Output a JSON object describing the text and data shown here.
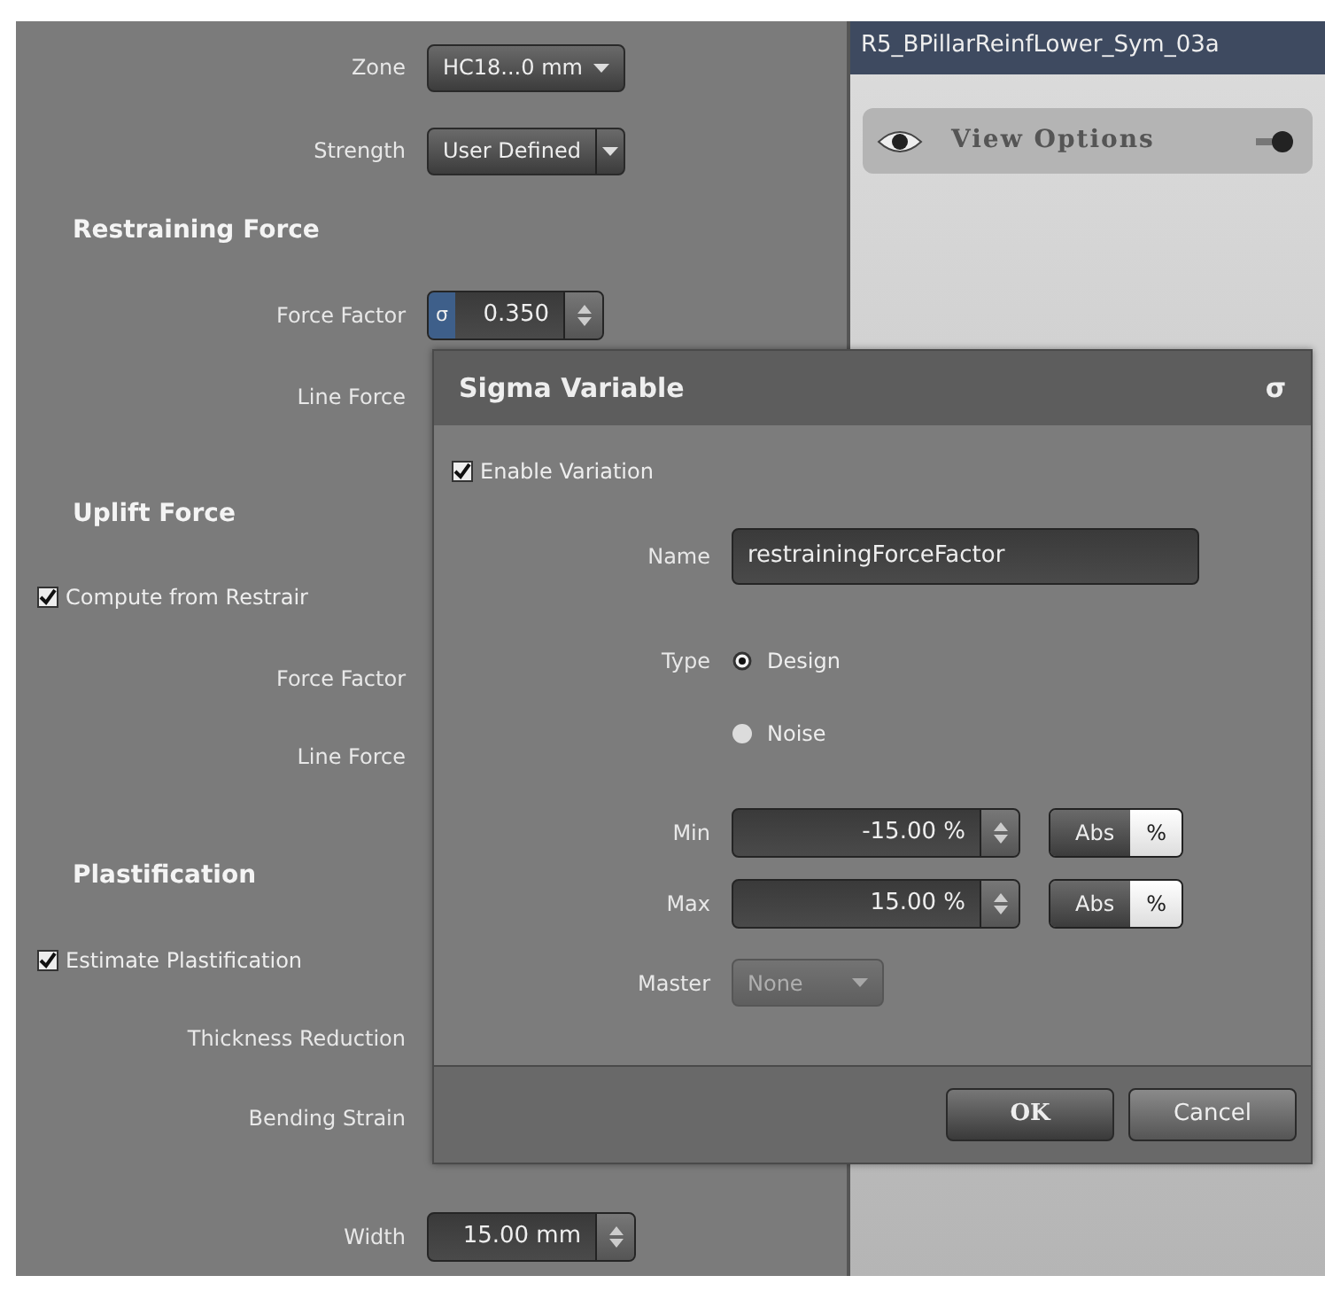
{
  "left_panel": {
    "rows": [
      {
        "kind": "dropdown",
        "label": "Zone",
        "value": "HC18...0 mm"
      },
      {
        "kind": "split_dropdown",
        "label": "Strength",
        "value": "User Defined"
      },
      {
        "kind": "heading",
        "label": "Restraining Force"
      },
      {
        "kind": "sigma_spin",
        "label": "Force Factor",
        "sigma": "σ",
        "value": "0.350"
      },
      {
        "kind": "label",
        "label": "Line Force"
      },
      {
        "kind": "heading",
        "label": "Uplift Force"
      },
      {
        "kind": "checkbox",
        "label": "Compute from Restrair",
        "checked": true
      },
      {
        "kind": "label",
        "label": "Force Factor"
      },
      {
        "kind": "label",
        "label": "Line Force"
      },
      {
        "kind": "heading",
        "label": "Plastification"
      },
      {
        "kind": "checkbox",
        "label": "Estimate Plastification",
        "checked": true
      },
      {
        "kind": "label",
        "label": "Thickness Reduction"
      },
      {
        "kind": "label",
        "label": "Bending Strain"
      },
      {
        "kind": "spin",
        "label": "Width",
        "value": "15.00 mm"
      }
    ]
  },
  "viewer": {
    "title": "R5_BPillarReinfLower_Sym_03a",
    "view_options": "View Options"
  },
  "dialog": {
    "title": "Sigma Variable",
    "title_symbol": "σ",
    "enable_variation": {
      "label": "Enable Variation",
      "checked": true
    },
    "name": {
      "label": "Name",
      "value": "restrainingForceFactor"
    },
    "type": {
      "label": "Type",
      "options": [
        {
          "label": "Design",
          "selected": true
        },
        {
          "label": "Noise",
          "selected": false
        }
      ]
    },
    "ranges": [
      {
        "label": "Min",
        "value": "-15.00 %",
        "modes": [
          {
            "label": "Abs",
            "selected": false
          },
          {
            "label": "%",
            "selected": true
          }
        ]
      },
      {
        "label": "Max",
        "value": "15.00 %",
        "modes": [
          {
            "label": "Abs",
            "selected": false
          },
          {
            "label": "%",
            "selected": true
          }
        ]
      }
    ],
    "master": {
      "label": "Master",
      "value": "None",
      "disabled": true
    },
    "buttons": [
      {
        "label": "OK",
        "default": true
      },
      {
        "label": "Cancel",
        "default": false
      }
    ]
  }
}
